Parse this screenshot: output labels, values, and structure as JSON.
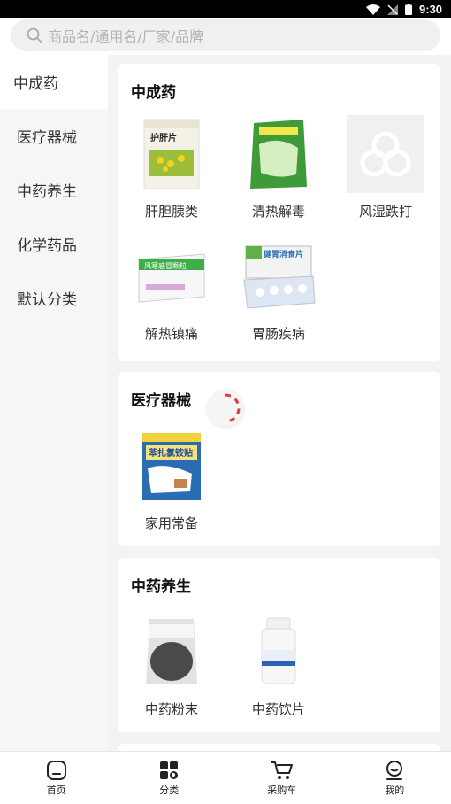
{
  "status_bar": {
    "time": "9:30"
  },
  "search": {
    "placeholder": "商品名/通用名/厂家/品牌"
  },
  "sidebar": {
    "items": [
      {
        "label": "中成药",
        "active": true
      },
      {
        "label": "医疗器械"
      },
      {
        "label": "中药养生"
      },
      {
        "label": "化学药品"
      },
      {
        "label": "默认分类"
      }
    ]
  },
  "sections": [
    {
      "title": "中成药",
      "items": [
        {
          "label": "肝胆胰类",
          "image_text": "护肝片"
        },
        {
          "label": "清热解毒"
        },
        {
          "label": "风湿跌打"
        },
        {
          "label": "解热镇痛",
          "image_text": "风寒感冒颗粒"
        },
        {
          "label": "胃肠疾病",
          "image_text": "健胃消食片"
        }
      ]
    },
    {
      "title": "医疗器械",
      "items": [
        {
          "label": "家用常备",
          "image_text": "苯扎氯铵贴"
        }
      ]
    },
    {
      "title": "中药养生",
      "items": [
        {
          "label": "中药粉末"
        },
        {
          "label": "中药饮片"
        }
      ]
    }
  ],
  "bottom_nav": {
    "items": [
      {
        "label": "首页",
        "icon": "home-icon"
      },
      {
        "label": "分类",
        "icon": "category-icon"
      },
      {
        "label": "采购车",
        "icon": "cart-icon"
      },
      {
        "label": "我的",
        "icon": "user-icon"
      }
    ]
  },
  "colors": {
    "accent_red": "#e53935",
    "text": "#222222",
    "placeholder": "#b3b3b3"
  }
}
